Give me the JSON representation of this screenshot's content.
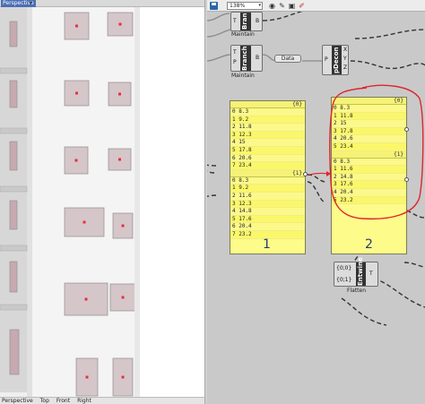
{
  "viewport": {
    "title": "Perspective",
    "menu_arrow": "▾",
    "tabs": [
      "Perspective",
      "Top",
      "Front",
      "Right"
    ]
  },
  "toolbar": {
    "zoom": "138%",
    "zoom_arrow": "▾",
    "icons": [
      "eye-icon",
      "paint-icon",
      "camera-icon",
      "brush-icon"
    ],
    "icon_glyphs": [
      "◉",
      "✎",
      "▣",
      "✐"
    ]
  },
  "components": {
    "branch_top": {
      "name": "Bran",
      "caption": "Maintain",
      "input": "T",
      "output": "B"
    },
    "branch": {
      "name": "Branch",
      "caption": "Maintain",
      "inputs": [
        "T",
        "P"
      ],
      "output": "B"
    },
    "relay": {
      "label": "Data"
    },
    "pdecon": {
      "name": "pDecon",
      "outputs": [
        "X",
        "Y",
        "Z"
      ],
      "input": "P"
    },
    "entwine": {
      "name": "Entwine",
      "inputs": [
        "{0;0}",
        "{0;1}"
      ],
      "output": "T",
      "caption": "Flatten"
    }
  },
  "panels": [
    {
      "groups": [
        {
          "path": "{0}",
          "items": [
            "0 8.3",
            "1 9.2",
            "2 11.8",
            "3 12.3",
            "4 15",
            "5 17.8",
            "6 20.6",
            "7 23.4"
          ]
        },
        {
          "path": "{1}",
          "items": [
            "0 8.3",
            "1 9.2",
            "2 11.6",
            "3 12.3",
            "4 14.8",
            "5 17.6",
            "6 20.4",
            "7 23.2"
          ]
        }
      ],
      "number": "1"
    },
    {
      "groups": [
        {
          "path": "{0}",
          "items": [
            "0 8.3",
            "1 11.8",
            "2 15",
            "3 17.8",
            "4 20.6",
            "5 23.4"
          ]
        },
        {
          "path": "{1}",
          "items": [
            "0 8.3",
            "1 11.6",
            "2 14.8",
            "3 17.6",
            "4 20.4",
            "5 23.2"
          ]
        }
      ],
      "number": "2"
    }
  ],
  "colors": {
    "panel_yellow": "#fdfb8a",
    "annotation_red": "#e0242c",
    "canvas_gray": "#c9c9c9",
    "window_marker": "#e53040"
  }
}
